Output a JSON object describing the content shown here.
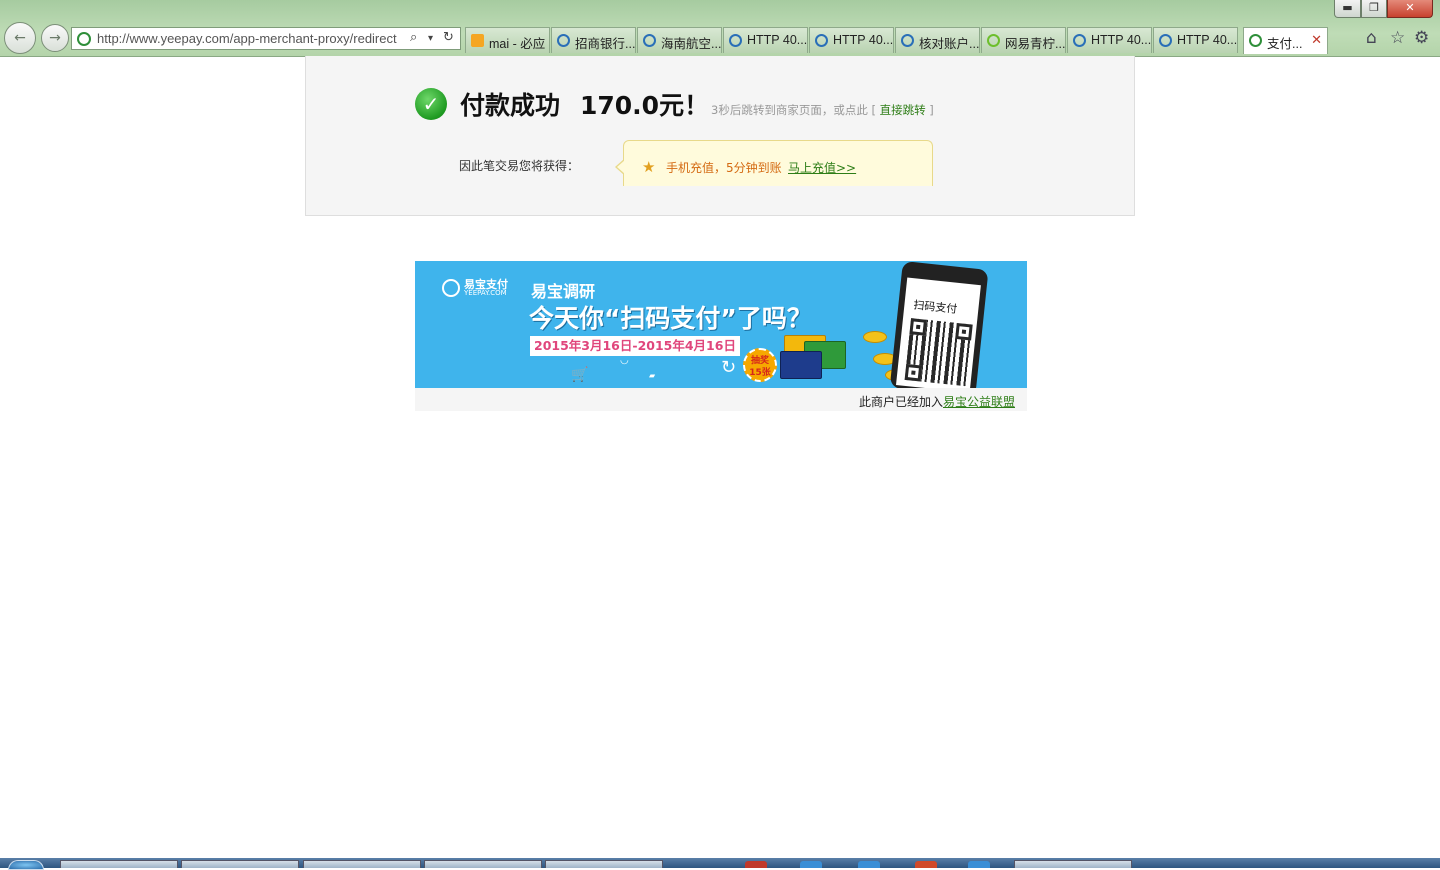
{
  "browser": {
    "window_controls": {
      "minimize": "▬",
      "maximize": "❐",
      "close": "✕"
    },
    "nav": {
      "back_icon": "←",
      "forward_icon": "→"
    },
    "address_bar": {
      "url": "http://www.yeepay.com/app-merchant-proxy/redirect",
      "tools": {
        "search": "⌕",
        "dropdown": "▾",
        "refresh": "↻"
      }
    },
    "tabs": [
      {
        "label": "mai - 必应",
        "icon": "bing-icon",
        "icon_color": "#f5a623"
      },
      {
        "label": "招商银行...",
        "icon": "ie-icon",
        "icon_color": "#2a6fb8"
      },
      {
        "label": "海南航空...",
        "icon": "ie-icon",
        "icon_color": "#2a6fb8"
      },
      {
        "label": "HTTP 40...",
        "icon": "ie-icon",
        "icon_color": "#2a6fb8"
      },
      {
        "label": "HTTP 40...",
        "icon": "ie-icon",
        "icon_color": "#2a6fb8"
      },
      {
        "label": "核对账户...",
        "icon": "ie-icon",
        "icon_color": "#2a6fb8"
      },
      {
        "label": "网易青柠...",
        "icon": "netease-icon",
        "icon_color": "#6dbf2c"
      },
      {
        "label": "HTTP 40...",
        "icon": "ie-icon",
        "icon_color": "#2a6fb8"
      },
      {
        "label": "HTTP 40...",
        "icon": "ie-icon",
        "icon_color": "#2a6fb8"
      },
      {
        "label": "支付...",
        "icon": "yeepay-icon",
        "icon_color": "#2f8f3a",
        "active": true
      }
    ],
    "tab_close": "✕",
    "toolbar": {
      "home": "⌂",
      "favorites": "☆",
      "settings": "⚙"
    }
  },
  "result": {
    "status_icon": "✓",
    "title": "付款成功",
    "amount": "170.0元！",
    "redirect_prefix": "3秒后跳转到商家页面，或点此 [ ",
    "redirect_link": "直接跳转",
    "redirect_suffix": " ]",
    "gain_label": "因此笔交易您将获得：",
    "gain_medal": "★",
    "gain_text": "手机充值，5分钟到账",
    "gain_link": "马上充值>>"
  },
  "banner": {
    "logo_cn": "易宝支付",
    "logo_en": "YEEPAY.COM",
    "kicker": "易宝调研",
    "headline": "今天你“扫码支付”了吗？",
    "dates": "2015年3月16日-2015年4月16日",
    "prize_badge": "抽奖15张",
    "phone_label": "扫码支付",
    "footer_prefix": "此商户已经加入",
    "footer_link": "易宝公益联盟"
  },
  "colors": {
    "success_green": "#1e9a21",
    "link_green": "#2d7d16",
    "orange_text": "#d46a12",
    "banner_blue": "#3fb4ec",
    "date_pink": "#e0467c"
  }
}
